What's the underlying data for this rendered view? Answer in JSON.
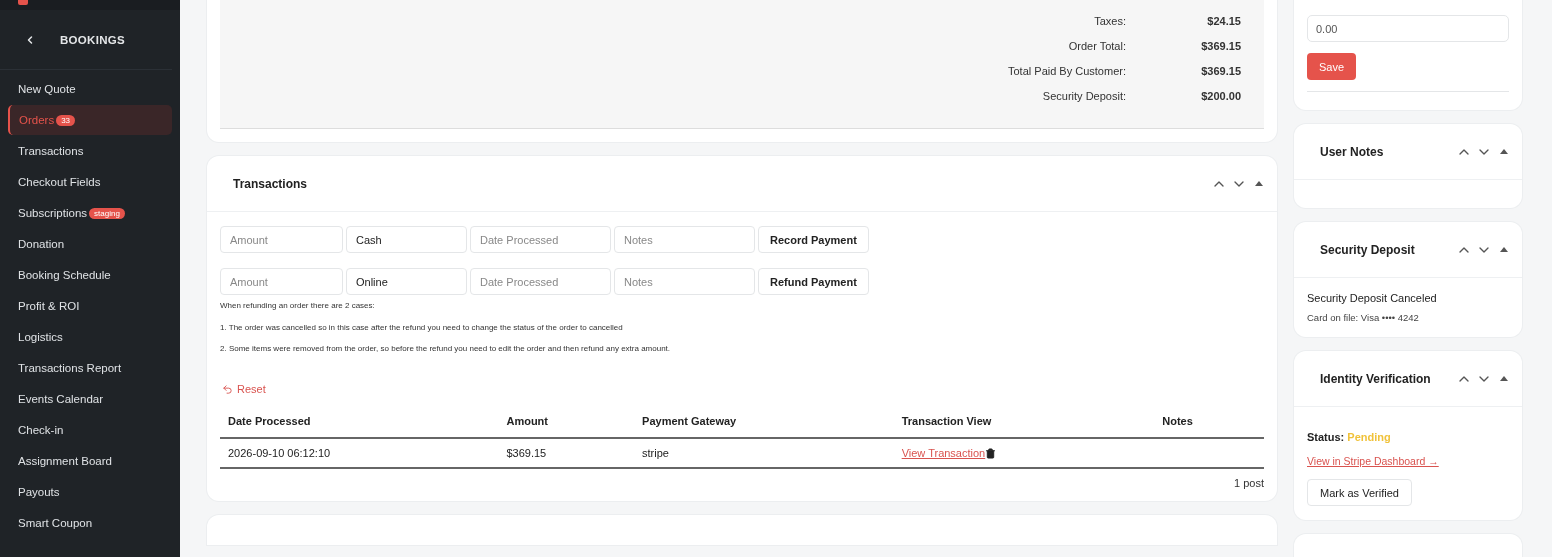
{
  "sidebar": {
    "section_title": "BOOKINGS",
    "items": [
      {
        "label": "New Quote",
        "selected": false
      },
      {
        "label": "Orders",
        "selected": true,
        "badge": "33"
      },
      {
        "label": "Transactions",
        "selected": false
      },
      {
        "label": "Checkout Fields",
        "selected": false
      },
      {
        "label": "Subscriptions",
        "selected": false,
        "badge": "staging"
      },
      {
        "label": "Donation",
        "selected": false
      },
      {
        "label": "Booking Schedule",
        "selected": false
      },
      {
        "label": "Profit & ROI",
        "selected": false
      },
      {
        "label": "Logistics",
        "selected": false
      },
      {
        "label": "Transactions Report",
        "selected": false
      },
      {
        "label": "Events Calendar",
        "selected": false
      },
      {
        "label": "Check-in",
        "selected": false
      },
      {
        "label": "Assignment Board",
        "selected": false
      },
      {
        "label": "Payouts",
        "selected": false
      },
      {
        "label": "Smart Coupon",
        "selected": false
      }
    ]
  },
  "order_summary": {
    "rows": [
      {
        "label": "Taxes:",
        "value": "$24.15"
      },
      {
        "label": "Order Total:",
        "value": "$369.15"
      },
      {
        "label": "Total Paid By Customer:",
        "value": "$369.15"
      },
      {
        "label": "Security Deposit:",
        "value": "$200.00"
      }
    ]
  },
  "transactions": {
    "title": "Transactions",
    "payment_rows": [
      {
        "amount_placeholder": "Amount",
        "method": "Cash",
        "date_placeholder": "Date Processed",
        "notes_placeholder": "Notes",
        "button": "Record Payment"
      },
      {
        "amount_placeholder": "Amount",
        "method": "Online",
        "date_placeholder": "Date Processed",
        "notes_placeholder": "Notes",
        "button": "Refund Payment"
      }
    ],
    "help_lines": [
      "When refunding an order there are 2 cases:",
      "1. The order was cancelled so in this case after the refund you need to change the status of the order to cancelled",
      "2. Some items were removed from the order, so before the refund you need to edit the order and then refund any extra amount."
    ],
    "reset": "Reset",
    "table": {
      "columns": [
        "Date Processed",
        "Amount",
        "Payment Gateway",
        "Transaction View",
        "Notes"
      ],
      "rows": [
        {
          "date": "2026-09-10 06:12:10",
          "amount": "$369.15",
          "gateway": "stripe",
          "view_link": "View Transaction"
        }
      ]
    },
    "footer": "1 post"
  },
  "price_panel": {
    "value": "0.00",
    "save": "Save"
  },
  "panels": [
    {
      "kind": "empty",
      "title": "User Notes"
    },
    {
      "kind": "deposit",
      "title": "Security Deposit",
      "status": "Security Deposit Canceled",
      "card": "Card on file: Visa •••• 4242"
    },
    {
      "kind": "identity",
      "title": "Identity Verification",
      "status_label": "Status:",
      "status": "Pending",
      "link": "View in Stripe Dashboard →",
      "button": "Mark as Verified"
    }
  ]
}
